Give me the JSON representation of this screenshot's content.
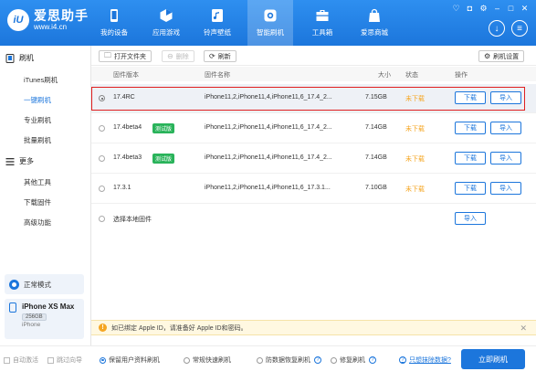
{
  "app": {
    "name": "爱思助手",
    "url": "www.i4.cn",
    "logo_mark": "iU"
  },
  "nav": [
    {
      "label": "我的设备",
      "icon": "phone-icon"
    },
    {
      "label": "应用游戏",
      "icon": "apps-icon"
    },
    {
      "label": "铃声壁纸",
      "icon": "ringtone-icon"
    },
    {
      "label": "智能刷机",
      "icon": "flash-icon",
      "active": true
    },
    {
      "label": "工具箱",
      "icon": "toolbox-icon"
    },
    {
      "label": "爱思商城",
      "icon": "store-icon"
    }
  ],
  "sidebar": {
    "flash_title": "刷机",
    "items": [
      {
        "label": "iTunes刷机"
      },
      {
        "label": "一键刷机",
        "active": true
      },
      {
        "label": "专业刷机"
      },
      {
        "label": "批量刷机"
      }
    ],
    "more_title": "更多",
    "more_items": [
      {
        "label": "其他工具"
      },
      {
        "label": "下载固件"
      },
      {
        "label": "高级功能"
      }
    ],
    "mode_label": "正常模式",
    "device": {
      "name": "iPhone XS Max",
      "capacity": "256GB",
      "type": "iPhone"
    }
  },
  "toolbar": {
    "open_folder": "打开文件夹",
    "delete": "删除",
    "refresh": "刷新",
    "flash_settings": "刷机设置"
  },
  "table": {
    "headers": {
      "version": "固件版本",
      "name": "固件名称",
      "size": "大小",
      "status": "状态",
      "action": "操作"
    },
    "rows": [
      {
        "version": "17.4RC",
        "badge": "",
        "name": "iPhone11,2,iPhone11,4,iPhone11,6_17.4_2...",
        "size": "7.15GB",
        "status": "未下载",
        "selected": true
      },
      {
        "version": "17.4beta4",
        "badge": "测试版",
        "name": "iPhone11,2,iPhone11,4,iPhone11,6_17.4_2...",
        "size": "7.14GB",
        "status": "未下载"
      },
      {
        "version": "17.4beta3",
        "badge": "测试版",
        "name": "iPhone11,2,iPhone11,4,iPhone11,6_17.4_2...",
        "size": "7.14GB",
        "status": "未下载"
      },
      {
        "version": "17.3.1",
        "badge": "",
        "name": "iPhone11,2,iPhone11,4,iPhone11,6_17.3.1...",
        "size": "7.10GB",
        "status": "未下载"
      }
    ],
    "local_label": "选择本地固件",
    "download_label": "下载",
    "import_label": "导入"
  },
  "notice": {
    "text": "如已绑定 Apple ID，请准备好 Apple ID和密码。"
  },
  "bottom": {
    "auto_activate": "自动激活",
    "skip_guide": "跳过向导",
    "options": [
      {
        "label": "保留用户资料刷机",
        "selected": true
      },
      {
        "label": "常规快速刷机"
      },
      {
        "label": "防数据恢复刷机"
      },
      {
        "label": "修复刷机"
      }
    ],
    "data_link": "只想抹除数据?",
    "flash_button": "立即刷机"
  },
  "colors": {
    "brand": "#1c76dc",
    "status": "#f5a623",
    "badge": "#29b35a",
    "highlight": "#e02020"
  }
}
